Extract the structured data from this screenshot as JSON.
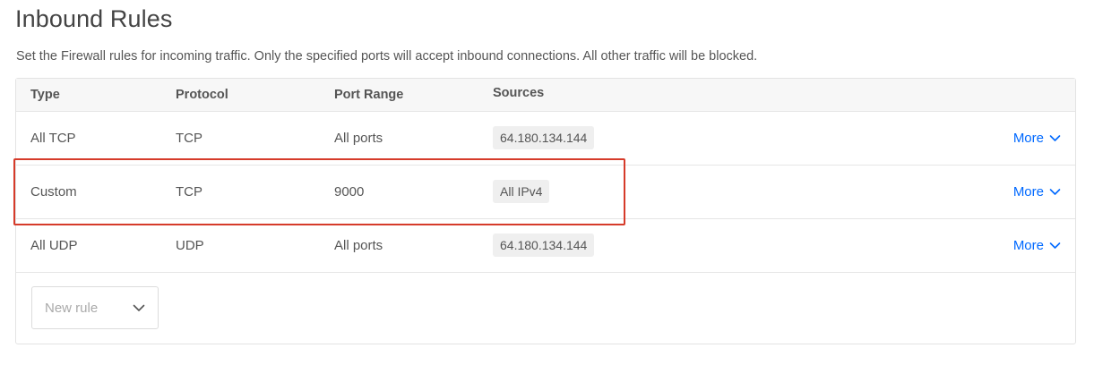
{
  "header": {
    "title": "Inbound Rules",
    "subtitle": "Set the Firewall rules for incoming traffic. Only the specified ports will accept inbound connections. All other traffic will be blocked."
  },
  "table": {
    "columns": {
      "type": "Type",
      "protocol": "Protocol",
      "port_range": "Port Range",
      "sources": "Sources"
    },
    "rows": [
      {
        "type": "All TCP",
        "protocol": "TCP",
        "port_range": "All ports",
        "source": "64.180.134.144",
        "more": "More"
      },
      {
        "type": "Custom",
        "protocol": "TCP",
        "port_range": "9000",
        "source": "All IPv4",
        "more": "More"
      },
      {
        "type": "All UDP",
        "protocol": "UDP",
        "port_range": "All ports",
        "source": "64.180.134.144",
        "more": "More"
      }
    ]
  },
  "new_rule": {
    "label": "New rule",
    "icon": "chevron-down-icon"
  },
  "icons": {
    "more_chevron": "chevron-down-icon"
  },
  "colors": {
    "link": "#0069ff",
    "highlight": "#d63b2a",
    "chip_bg": "#efefef"
  }
}
